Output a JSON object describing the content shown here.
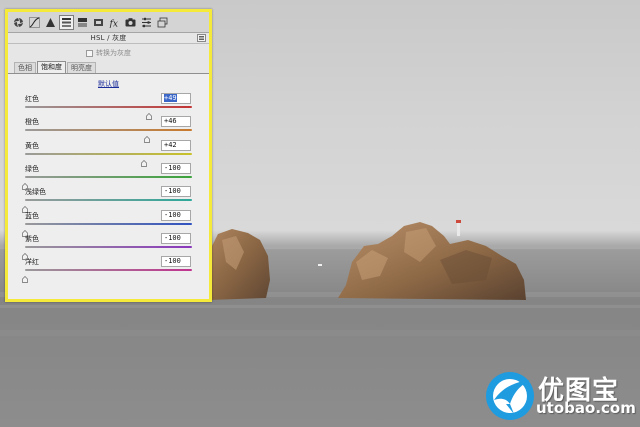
{
  "panel": {
    "title": "HSL / 灰度",
    "convert_grayscale_label": "转换为灰度",
    "tabs": [
      {
        "label": "色相",
        "active": false
      },
      {
        "label": "饱和度",
        "active": true
      },
      {
        "label": "明亮度",
        "active": false
      }
    ],
    "default_link": "默认值",
    "sliders": [
      {
        "label": "红色",
        "value": "+49",
        "fraction": 0.745,
        "color": "#c43434",
        "selected": true
      },
      {
        "label": "橙色",
        "value": "+46",
        "fraction": 0.73,
        "color": "#c97a2c",
        "selected": false
      },
      {
        "label": "黄色",
        "value": "+42",
        "fraction": 0.71,
        "color": "#c9c22a",
        "selected": false
      },
      {
        "label": "绿色",
        "value": "-100",
        "fraction": 0.0,
        "color": "#3aa33a",
        "selected": false
      },
      {
        "label": "浅绿色",
        "value": "-100",
        "fraction": 0.0,
        "color": "#2da89a",
        "selected": false
      },
      {
        "label": "蓝色",
        "value": "-100",
        "fraction": 0.0,
        "color": "#2f52c0",
        "selected": false
      },
      {
        "label": "紫色",
        "value": "-100",
        "fraction": 0.0,
        "color": "#8a36bd",
        "selected": false
      },
      {
        "label": "洋红",
        "value": "-100",
        "fraction": 0.0,
        "color": "#c0338f",
        "selected": false
      }
    ],
    "toolbar_icons": [
      "aperture-icon",
      "tone-curve-icon",
      "detail-icon",
      "hsl-icon",
      "split-toning-icon",
      "lens-corrections-icon",
      "effects-icon",
      "camera-calibration-icon",
      "presets-icon",
      "snapshots-icon"
    ],
    "highlight_color": "#f5e93a"
  },
  "watermark": {
    "brand": "优图宝",
    "url": "utobao.com",
    "accent": "#1f9be0"
  }
}
